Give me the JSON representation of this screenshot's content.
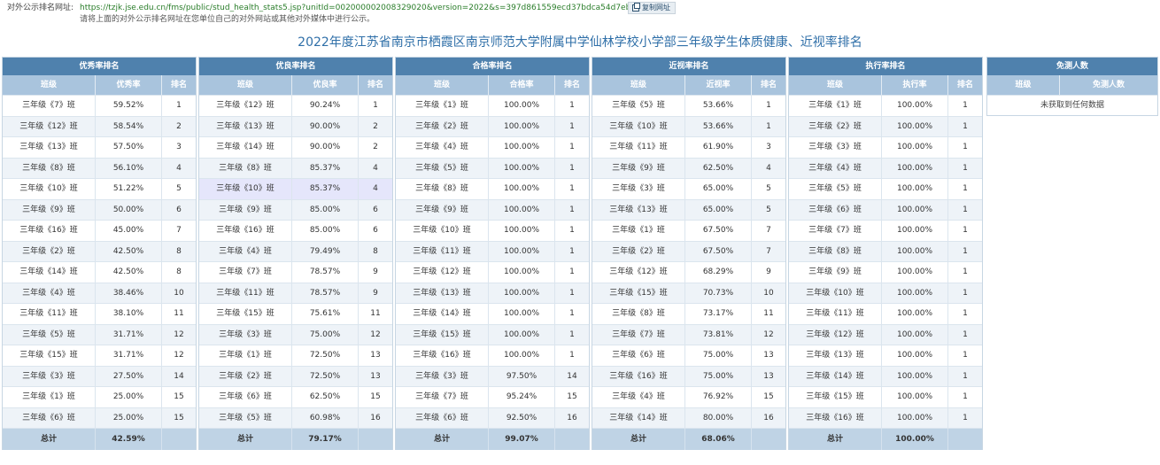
{
  "top": {
    "url_label": "对外公示排名网址:",
    "url": "https://tzjk.jse.edu.cn/fms/public/stud_health_stats5.jsp?unitId=002000002008329020&version=2022&s=397d861559ecd37bdca54d7eb28e714c",
    "copy_button": "复制网址",
    "notice": "请将上面的对外公示排名网址在您单位自己的对外网站或其他对外媒体中进行公示。"
  },
  "page_title": "2022年度江苏省南京市栖霞区南京师范大学附属中学仙林学校小学部三年级学生体质健康、近视率排名",
  "tables": [
    {
      "title": "优秀率排名",
      "headers": [
        "班级",
        "优秀率",
        "排名"
      ],
      "rows": [
        [
          "三年级《7》班",
          "59.52%",
          "1"
        ],
        [
          "三年级《12》班",
          "58.54%",
          "2"
        ],
        [
          "三年级《13》班",
          "57.50%",
          "3"
        ],
        [
          "三年级《8》班",
          "56.10%",
          "4"
        ],
        [
          "三年级《10》班",
          "51.22%",
          "5"
        ],
        [
          "三年级《9》班",
          "50.00%",
          "6"
        ],
        [
          "三年级《16》班",
          "45.00%",
          "7"
        ],
        [
          "三年级《2》班",
          "42.50%",
          "8"
        ],
        [
          "三年级《14》班",
          "42.50%",
          "8"
        ],
        [
          "三年级《4》班",
          "38.46%",
          "10"
        ],
        [
          "三年级《11》班",
          "38.10%",
          "11"
        ],
        [
          "三年级《5》班",
          "31.71%",
          "12"
        ],
        [
          "三年级《15》班",
          "31.71%",
          "12"
        ],
        [
          "三年级《3》班",
          "27.50%",
          "14"
        ],
        [
          "三年级《1》班",
          "25.00%",
          "15"
        ],
        [
          "三年级《6》班",
          "25.00%",
          "15"
        ]
      ],
      "total_label": "总计",
      "total_value": "42.59%"
    },
    {
      "title": "优良率排名",
      "headers": [
        "班级",
        "优良率",
        "排名"
      ],
      "rows": [
        [
          "三年级《12》班",
          "90.24%",
          "1"
        ],
        [
          "三年级《13》班",
          "90.00%",
          "2"
        ],
        [
          "三年级《14》班",
          "90.00%",
          "2"
        ],
        [
          "三年级《8》班",
          "85.37%",
          "4"
        ],
        [
          "三年级《10》班",
          "85.37%",
          "4"
        ],
        [
          "三年级《9》班",
          "85.00%",
          "6"
        ],
        [
          "三年级《16》班",
          "85.00%",
          "6"
        ],
        [
          "三年级《4》班",
          "79.49%",
          "8"
        ],
        [
          "三年级《7》班",
          "78.57%",
          "9"
        ],
        [
          "三年级《11》班",
          "78.57%",
          "9"
        ],
        [
          "三年级《15》班",
          "75.61%",
          "11"
        ],
        [
          "三年级《3》班",
          "75.00%",
          "12"
        ],
        [
          "三年级《1》班",
          "72.50%",
          "13"
        ],
        [
          "三年级《2》班",
          "72.50%",
          "13"
        ],
        [
          "三年级《6》班",
          "62.50%",
          "15"
        ],
        [
          "三年级《5》班",
          "60.98%",
          "16"
        ]
      ],
      "total_label": "总计",
      "total_value": "79.17%"
    },
    {
      "title": "合格率排名",
      "headers": [
        "班级",
        "合格率",
        "排名"
      ],
      "rows": [
        [
          "三年级《1》班",
          "100.00%",
          "1"
        ],
        [
          "三年级《2》班",
          "100.00%",
          "1"
        ],
        [
          "三年级《4》班",
          "100.00%",
          "1"
        ],
        [
          "三年级《5》班",
          "100.00%",
          "1"
        ],
        [
          "三年级《8》班",
          "100.00%",
          "1"
        ],
        [
          "三年级《9》班",
          "100.00%",
          "1"
        ],
        [
          "三年级《10》班",
          "100.00%",
          "1"
        ],
        [
          "三年级《11》班",
          "100.00%",
          "1"
        ],
        [
          "三年级《12》班",
          "100.00%",
          "1"
        ],
        [
          "三年级《13》班",
          "100.00%",
          "1"
        ],
        [
          "三年级《14》班",
          "100.00%",
          "1"
        ],
        [
          "三年级《15》班",
          "100.00%",
          "1"
        ],
        [
          "三年级《16》班",
          "100.00%",
          "1"
        ],
        [
          "三年级《3》班",
          "97.50%",
          "14"
        ],
        [
          "三年级《7》班",
          "95.24%",
          "15"
        ],
        [
          "三年级《6》班",
          "92.50%",
          "16"
        ]
      ],
      "total_label": "总计",
      "total_value": "99.07%"
    },
    {
      "title": "近视率排名",
      "headers": [
        "班级",
        "近视率",
        "排名"
      ],
      "rows": [
        [
          "三年级《5》班",
          "53.66%",
          "1"
        ],
        [
          "三年级《10》班",
          "53.66%",
          "1"
        ],
        [
          "三年级《11》班",
          "61.90%",
          "3"
        ],
        [
          "三年级《9》班",
          "62.50%",
          "4"
        ],
        [
          "三年级《3》班",
          "65.00%",
          "5"
        ],
        [
          "三年级《13》班",
          "65.00%",
          "5"
        ],
        [
          "三年级《1》班",
          "67.50%",
          "7"
        ],
        [
          "三年级《2》班",
          "67.50%",
          "7"
        ],
        [
          "三年级《12》班",
          "68.29%",
          "9"
        ],
        [
          "三年级《15》班",
          "70.73%",
          "10"
        ],
        [
          "三年级《8》班",
          "73.17%",
          "11"
        ],
        [
          "三年级《7》班",
          "73.81%",
          "12"
        ],
        [
          "三年级《6》班",
          "75.00%",
          "13"
        ],
        [
          "三年级《16》班",
          "75.00%",
          "13"
        ],
        [
          "三年级《4》班",
          "76.92%",
          "15"
        ],
        [
          "三年级《14》班",
          "80.00%",
          "16"
        ]
      ],
      "total_label": "总计",
      "total_value": "68.06%"
    },
    {
      "title": "执行率排名",
      "headers": [
        "班级",
        "执行率",
        "排名"
      ],
      "rows": [
        [
          "三年级《1》班",
          "100.00%",
          "1"
        ],
        [
          "三年级《2》班",
          "100.00%",
          "1"
        ],
        [
          "三年级《3》班",
          "100.00%",
          "1"
        ],
        [
          "三年级《4》班",
          "100.00%",
          "1"
        ],
        [
          "三年级《5》班",
          "100.00%",
          "1"
        ],
        [
          "三年级《6》班",
          "100.00%",
          "1"
        ],
        [
          "三年级《7》班",
          "100.00%",
          "1"
        ],
        [
          "三年级《8》班",
          "100.00%",
          "1"
        ],
        [
          "三年级《9》班",
          "100.00%",
          "1"
        ],
        [
          "三年级《10》班",
          "100.00%",
          "1"
        ],
        [
          "三年级《11》班",
          "100.00%",
          "1"
        ],
        [
          "三年级《12》班",
          "100.00%",
          "1"
        ],
        [
          "三年级《13》班",
          "100.00%",
          "1"
        ],
        [
          "三年级《14》班",
          "100.00%",
          "1"
        ],
        [
          "三年级《15》班",
          "100.00%",
          "1"
        ],
        [
          "三年级《16》班",
          "100.00%",
          "1"
        ]
      ],
      "total_label": "总计",
      "total_value": "100.00%"
    }
  ],
  "exempt": {
    "title": "免测人数",
    "headers": [
      "班级",
      "免测人数"
    ],
    "empty_text": "未获取到任何数据"
  }
}
